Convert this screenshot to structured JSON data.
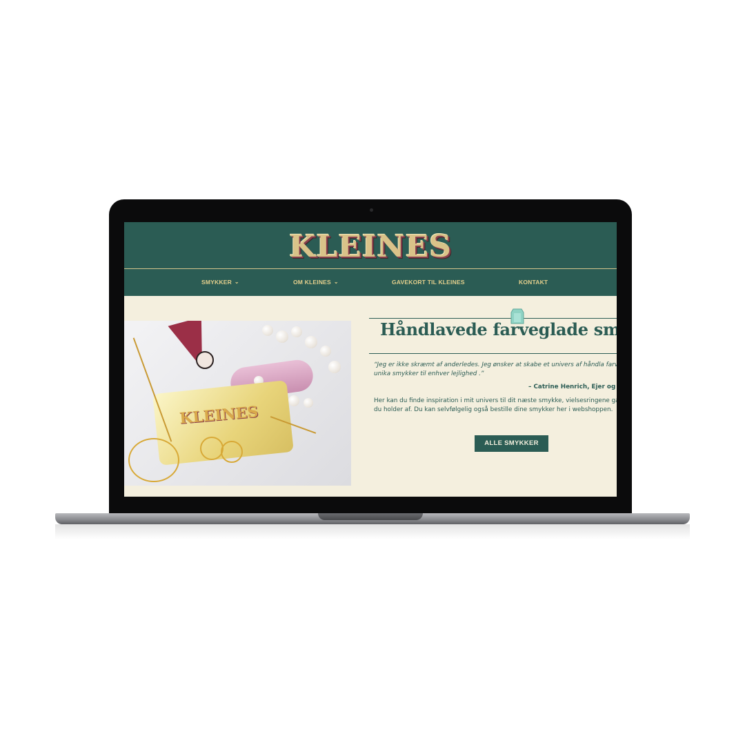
{
  "site": {
    "logo_text": "KLEINES"
  },
  "nav": {
    "items": [
      {
        "label": "SMYKKER",
        "has_dropdown": true
      },
      {
        "label": "OM KLEINES",
        "has_dropdown": true
      },
      {
        "label": "GAVEKORT TIL KLEINES",
        "has_dropdown": false
      },
      {
        "label": "KONTAKT",
        "has_dropdown": false
      }
    ],
    "dropdown_icon": "chevron-down-icon"
  },
  "hero": {
    "image_card_text": "KLEINES",
    "headline": "Håndlavede farveglade smyk",
    "quote": "“Jeg er ikke skræmt af anderledes. Jeg ønsker at skabe et univers af håndla farveglade unika smykker til enhver lejlighed .”",
    "attribution": "– Catrine Henrich, Ejer og i",
    "body": "Her kan du finde inspiration i mit univers til dit næste smykke, vielsesringene gaven til en du holder af. Du kan selvfølgelig også bestille dine smykker her i webshoppen.",
    "cta_label": "ALLE SMYKKER"
  },
  "colors": {
    "brand_green": "#2b5c54",
    "cream": "#f4efde",
    "gold": "#e3cf8c",
    "gem": "#8fd3c4"
  }
}
